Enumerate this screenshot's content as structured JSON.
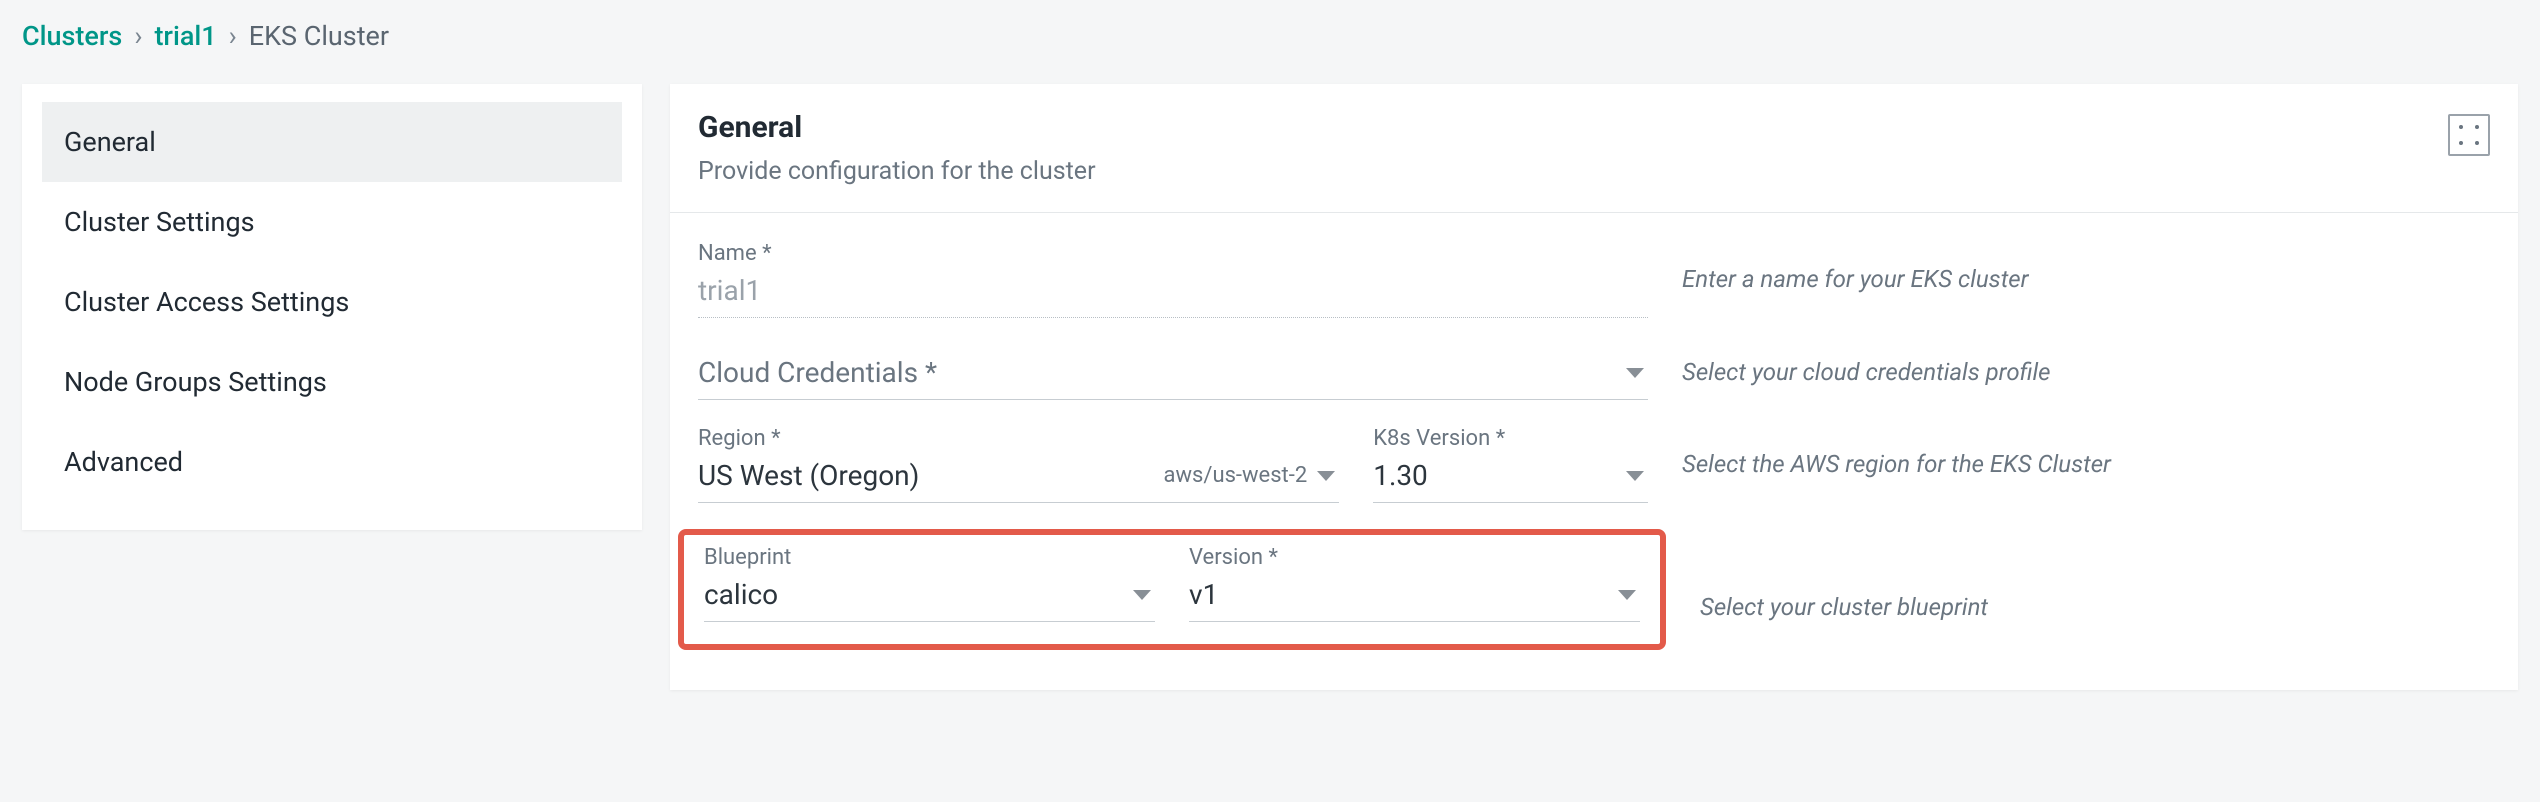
{
  "breadcrumb": {
    "root": "Clusters",
    "mid": "trial1",
    "cur": "EKS Cluster"
  },
  "sidebar": {
    "items": [
      {
        "label": "General",
        "active": true
      },
      {
        "label": "Cluster Settings",
        "active": false
      },
      {
        "label": "Cluster Access Settings",
        "active": false
      },
      {
        "label": "Node Groups Settings",
        "active": false
      },
      {
        "label": "Advanced",
        "active": false
      }
    ]
  },
  "main": {
    "title": "General",
    "subtitle": "Provide configuration for the cluster"
  },
  "fields": {
    "name": {
      "label": "Name *",
      "value": "trial1"
    },
    "creds": {
      "label": "Cloud Credentials *",
      "value": ""
    },
    "region": {
      "label": "Region *",
      "value": "US West (Oregon)",
      "sub": "aws/us-west-2"
    },
    "k8s": {
      "label": "K8s Version *",
      "value": "1.30"
    },
    "blueprint": {
      "label": "Blueprint",
      "value": "calico"
    },
    "version": {
      "label": "Version *",
      "value": "v1"
    }
  },
  "hints": {
    "name": "Enter a name for your EKS cluster",
    "creds": "Select your cloud credentials profile",
    "region": "Select the AWS region for the EKS Cluster",
    "blueprint": "Select your cluster blueprint"
  }
}
